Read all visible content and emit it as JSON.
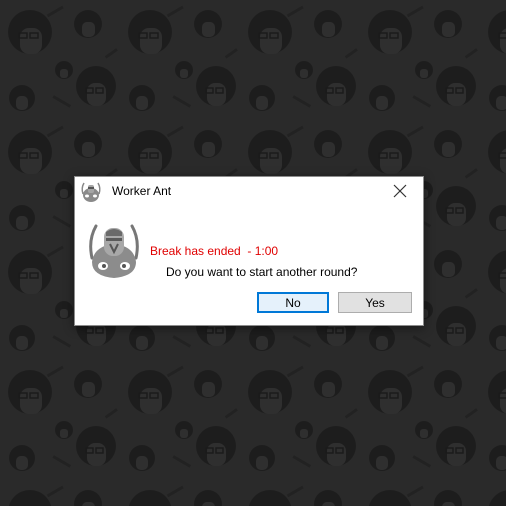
{
  "dialog": {
    "title": "Worker Ant",
    "app_icon": "worker-ant-icon",
    "close_icon": "close-icon",
    "message_icon": "worker-ant-face-icon",
    "status_message": "Break has ended  - 1:00",
    "question": "Do you want to start another round?",
    "no_label": "No",
    "yes_label": "Yes",
    "default_button": "No"
  },
  "colors": {
    "status_message": "#e00000",
    "default_button_border": "#0078d7",
    "wallpaper_background": "#2a2a2a"
  }
}
